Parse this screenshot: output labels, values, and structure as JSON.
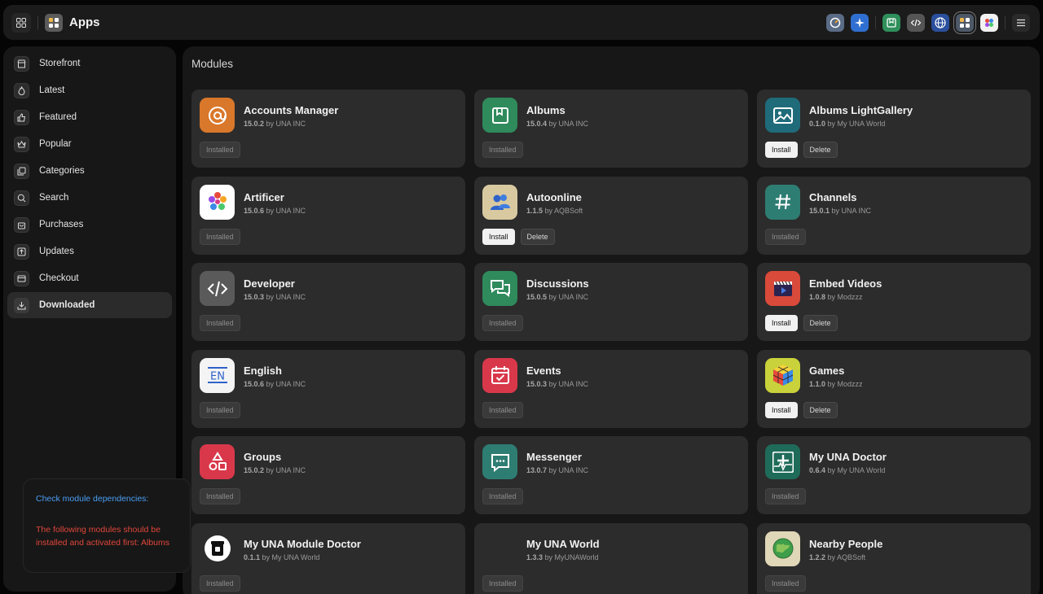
{
  "header": {
    "title": "Apps",
    "left_icons": [
      "grid-icon",
      "apps-icon"
    ],
    "right_icons": [
      {
        "name": "speedometer-icon",
        "color": "#5a6b86"
      },
      {
        "name": "sparkle-icon",
        "color": "#2f6fd1"
      },
      {
        "name": "bookmark-icon",
        "color": "#2f8f5b"
      },
      {
        "name": "code-icon",
        "color": "#555555"
      },
      {
        "name": "globe-icon",
        "color": "#2a4f9c"
      },
      {
        "name": "apps-icon",
        "color": "#4d5868"
      },
      {
        "name": "palette-icon",
        "color": "#f2f2f2"
      },
      {
        "name": "hamburger-menu-icon",
        "color": "#2a2a2a"
      }
    ]
  },
  "sidebar": {
    "items": [
      {
        "label": "Storefront",
        "icon": "store-icon"
      },
      {
        "label": "Latest",
        "icon": "flame-icon"
      },
      {
        "label": "Featured",
        "icon": "thumbs-up-icon"
      },
      {
        "label": "Popular",
        "icon": "crown-icon"
      },
      {
        "label": "Categories",
        "icon": "categories-icon"
      },
      {
        "label": "Search",
        "icon": "search-icon"
      },
      {
        "label": "Purchases",
        "icon": "bag-icon"
      },
      {
        "label": "Updates",
        "icon": "upload-icon"
      },
      {
        "label": "Checkout",
        "icon": "card-icon"
      },
      {
        "label": "Downloaded",
        "icon": "download-icon",
        "active": true
      }
    ]
  },
  "popup": {
    "title": "Check module dependencies:",
    "message": "The following modules should be installed and activated first: Albums"
  },
  "main": {
    "title": "Modules",
    "installed_label": "Installed",
    "install_label": "Install",
    "delete_label": "Delete",
    "cards": [
      {
        "name": "Accounts Manager",
        "version": "15.0.2",
        "vendor": "by UNA INC",
        "status": "installed",
        "icon": "at-sign-icon",
        "icon_color": "#d9772a"
      },
      {
        "name": "Albums",
        "version": "15.0.4",
        "vendor": "by UNA INC",
        "status": "installed",
        "icon": "album-icon",
        "icon_color": "#2f8a5c"
      },
      {
        "name": "Albums LightGallery",
        "version": "0.1.0",
        "vendor": "by My UNA World",
        "status": "available",
        "icon": "picture-icon",
        "icon_color": "#1f6b7a"
      },
      {
        "name": "Artificer",
        "version": "15.0.6",
        "vendor": "by UNA INC",
        "status": "installed",
        "icon": "artificer-icon",
        "icon_color": "#ffffff"
      },
      {
        "name": "Autoonline",
        "version": "1.1.5",
        "vendor": "by AQBSoft",
        "status": "available",
        "icon": "users-icon",
        "icon_color": "#d8c9a0"
      },
      {
        "name": "Channels",
        "version": "15.0.1",
        "vendor": "by UNA INC",
        "status": "installed",
        "icon": "hashtag-icon",
        "icon_color": "#2e7d72"
      },
      {
        "name": "Developer",
        "version": "15.0.3",
        "vendor": "by UNA INC",
        "status": "installed",
        "icon": "code-icon",
        "icon_color": "#5a5a5a"
      },
      {
        "name": "Discussions",
        "version": "15.0.5",
        "vendor": "by UNA INC",
        "status": "installed",
        "icon": "chat-icon",
        "icon_color": "#2f8a5c"
      },
      {
        "name": "Embed Videos",
        "version": "1.0.8",
        "vendor": "by Modzzz",
        "status": "available",
        "icon": "video-icon",
        "icon_color": "#d94a3a"
      },
      {
        "name": "English",
        "version": "15.0.6",
        "vendor": "by UNA INC",
        "status": "installed",
        "icon": "language-icon",
        "icon_color": "#f4f4f4"
      },
      {
        "name": "Events",
        "version": "15.0.3",
        "vendor": "by UNA INC",
        "status": "installed",
        "icon": "calendar-icon",
        "icon_color": "#d8384a"
      },
      {
        "name": "Games",
        "version": "1.1.0",
        "vendor": "by Modzzz",
        "status": "available",
        "icon": "cube-icon",
        "icon_color": "#c9d23a"
      },
      {
        "name": "Groups",
        "version": "15.0.2",
        "vendor": "by UNA INC",
        "status": "installed",
        "icon": "shapes-icon",
        "icon_color": "#d8384a"
      },
      {
        "name": "Messenger",
        "version": "13.0.7",
        "vendor": "by UNA INC",
        "status": "installed",
        "icon": "message-icon",
        "icon_color": "#2e7d72"
      },
      {
        "name": "My UNA Doctor",
        "version": "0.6.4",
        "vendor": "by My UNA World",
        "status": "installed",
        "icon": "doctor-icon",
        "icon_color": "#1f6b5a"
      },
      {
        "name": "My UNA Module Doctor",
        "version": "0.1.1",
        "vendor": "by My UNA World",
        "status": "installed",
        "icon": "module-doctor-icon",
        "icon_color": "#ffffff"
      },
      {
        "name": "My UNA World",
        "version": "1.3.3",
        "vendor": "by MyUNAWorld",
        "status": "installed",
        "icon": "",
        "icon_color": ""
      },
      {
        "name": "Nearby People",
        "version": "1.2.2",
        "vendor": "by AQBSoft",
        "status": "installed",
        "icon": "globe-people-icon",
        "icon_color": "#e0d6b8"
      }
    ]
  }
}
